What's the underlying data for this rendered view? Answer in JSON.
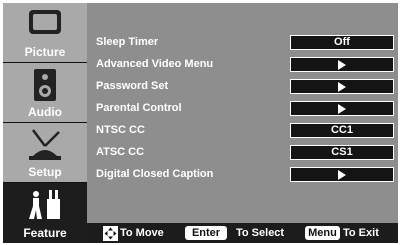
{
  "sidebar": {
    "tabs": [
      {
        "label": "Picture",
        "icon": "picture-icon",
        "active": false
      },
      {
        "label": "Audio",
        "icon": "speaker-icon",
        "active": false
      },
      {
        "label": "Setup",
        "icon": "antenna-icon",
        "active": false
      },
      {
        "label": "Feature",
        "icon": "feature-icon",
        "active": true
      }
    ]
  },
  "menu": {
    "items": [
      {
        "label": "Sleep Timer",
        "value": "Off"
      },
      {
        "label": "Advanced Video Menu",
        "value": "",
        "icon": "play-arrow-icon"
      },
      {
        "label": "Password Set",
        "value": "",
        "icon": "play-arrow-icon"
      },
      {
        "label": "Parental Control",
        "value": "",
        "icon": "play-arrow-icon"
      },
      {
        "label": "NTSC CC",
        "value": "CC1"
      },
      {
        "label": "ATSC CC",
        "value": "CS1"
      },
      {
        "label": "Digital Closed Caption",
        "value": "",
        "icon": "play-arrow-icon"
      }
    ]
  },
  "footer": {
    "move_text": "To Move",
    "enter_key": "Enter",
    "select_text": "To Select",
    "menu_key": "Menu",
    "exit_text": "To Exit"
  },
  "colors": {
    "content_bg": "#8e8e8e",
    "sidebar_inactive": "#a9a9a9",
    "sidebar_active": "#1d1d1d",
    "value_box": "#141414"
  }
}
